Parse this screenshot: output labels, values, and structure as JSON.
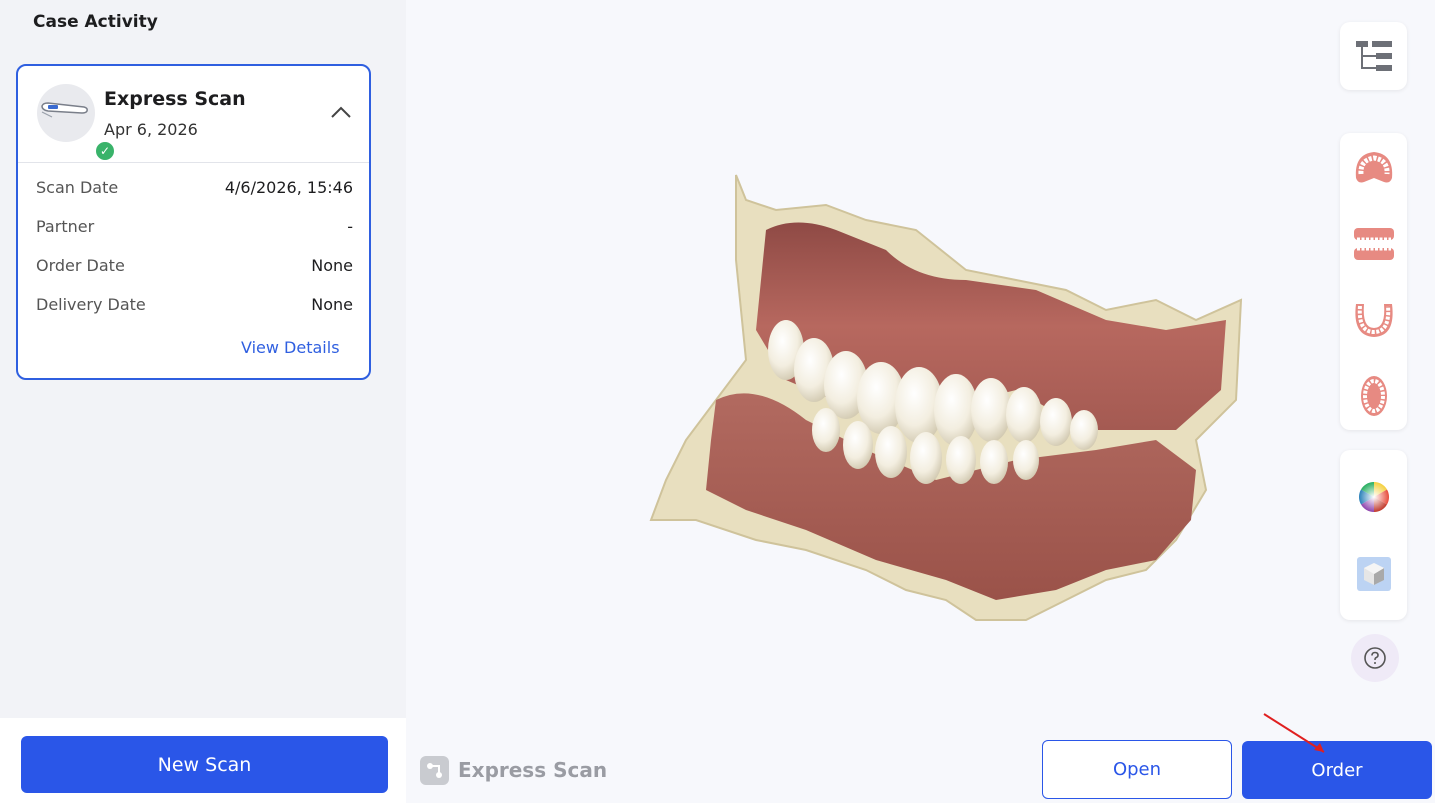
{
  "sidebar": {
    "title": "Case Activity",
    "card": {
      "title": "Express Scan",
      "date": "Apr 6, 2026",
      "status": "complete",
      "rows": [
        {
          "label": "Scan Date",
          "value": "4/6/2026, 15:46"
        },
        {
          "label": "Partner",
          "value": "-"
        },
        {
          "label": "Order Date",
          "value": "None"
        },
        {
          "label": "Delivery Date",
          "value": "None"
        }
      ],
      "view_details": "View Details"
    },
    "new_scan_label": "New Scan"
  },
  "toolbar": {
    "icons": [
      "tree-view-icon",
      "upper-jaw-icon",
      "both-jaws-icon",
      "lower-jaw-icon",
      "upper-jaw-occlusal-icon",
      "color-wheel-icon",
      "mono-cube-icon",
      "help-icon"
    ]
  },
  "footer": {
    "brand_name": "Express Scan",
    "open_label": "Open",
    "order_label": "Order"
  },
  "colors": {
    "accent": "#2a56e8",
    "success": "#39b36a",
    "annotation": "#e02020"
  }
}
